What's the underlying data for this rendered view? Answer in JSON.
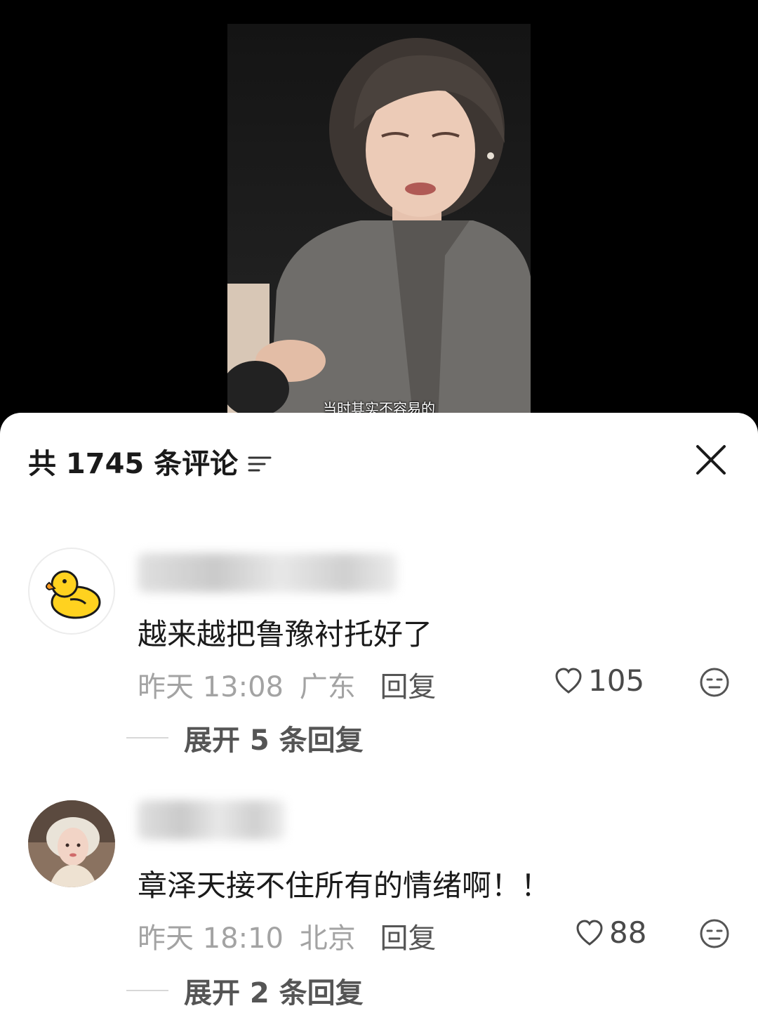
{
  "video": {
    "subtitle": "当时其实不容易的"
  },
  "comments_sheet": {
    "title": "共 1745 条评论",
    "comments": [
      {
        "text": "越来越把鲁豫衬托好了",
        "time": "昨天 13:08",
        "location": "广东",
        "reply_label": "回复",
        "likes": "105",
        "expand_label": "展开 5 条回复"
      },
      {
        "text": "章泽天接不住所有的情绪啊！！",
        "time": "昨天 18:10",
        "location": "北京",
        "reply_label": "回复",
        "likes": "88",
        "expand_label": "展开 2 条回复"
      }
    ]
  },
  "icons": {
    "sort": "sort-lines-icon",
    "close": "close-icon",
    "like": "heart-outline-icon",
    "emoji": "neutral-face-icon",
    "avatar_1": "yellow-duck-avatar",
    "avatar_2": "woman-photo-avatar"
  },
  "colors": {
    "sheet_bg": "#ffffff",
    "meta_text": "#a3a3a3",
    "duck": "#ffd21f"
  }
}
